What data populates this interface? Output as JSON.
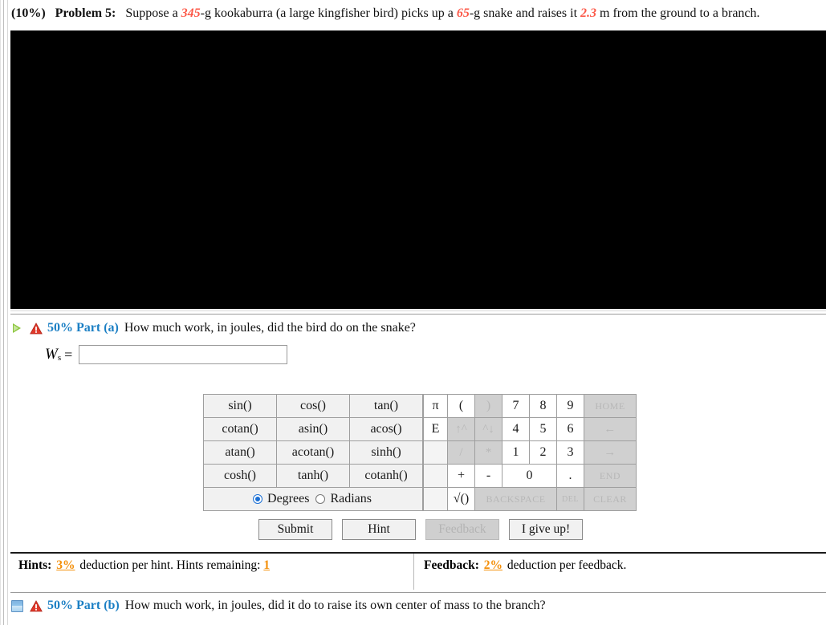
{
  "problem": {
    "percent": "(10%)",
    "label": "Problem 5:",
    "text_1": "Suppose a ",
    "val_mass_bird": "345",
    "text_2": "-g kookaburra (a large kingfisher bird) picks up a ",
    "val_mass_snake": "65",
    "text_3": "-g snake and raises it ",
    "val_height": "2.3",
    "text_4": " m from the ground to a branch."
  },
  "part_a": {
    "weight_label": "50% Part (a)",
    "question": "How much work, in joules, did the bird do on the snake?",
    "toggle_icon": "play-triangle-icon",
    "status_icon": "warning-icon"
  },
  "answer": {
    "symbol": "W",
    "subscript": "s",
    "equals": "=",
    "value": "",
    "placeholder": ""
  },
  "keypad": {
    "functions": [
      [
        "sin()",
        "cos()",
        "tan()"
      ],
      [
        "cotan()",
        "asin()",
        "acos()"
      ],
      [
        "atan()",
        "acotan()",
        "sinh()"
      ],
      [
        "cosh()",
        "tanh()",
        "cotanh()"
      ]
    ],
    "mode": {
      "degrees_label": "Degrees",
      "radians_label": "Radians",
      "selected": "Degrees"
    },
    "numeric": {
      "row1": [
        "π",
        "(",
        ")",
        "7",
        "8",
        "9",
        "HOME"
      ],
      "row2": [
        "E",
        "↑^",
        "^↓",
        "4",
        "5",
        "6",
        "←"
      ],
      "row3": [
        "",
        "/",
        "*",
        "1",
        "2",
        "3",
        "→"
      ],
      "row4": [
        "",
        "+",
        "-",
        "0",
        ".",
        "END"
      ],
      "row5": [
        "",
        "√()",
        "BACKSPACE",
        "DEL",
        "CLEAR"
      ]
    }
  },
  "actions": {
    "submit": "Submit",
    "hint": "Hint",
    "feedback": "Feedback",
    "give_up": "I give up!"
  },
  "hints": {
    "title": "Hints:",
    "deduction": "3%",
    "text_mid": " deduction per hint. Hints remaining: ",
    "remaining": "1"
  },
  "feedback": {
    "title": "Feedback:",
    "deduction": "2%",
    "text": " deduction per feedback."
  },
  "part_b": {
    "weight_label": "50% Part (b)",
    "question": "How much work, in joules, did it do to raise its own center of mass to the branch?",
    "toggle_icon": "collapsed-square-icon",
    "status_icon": "warning-icon"
  },
  "colors": {
    "accent_blue": "#1b7fc4",
    "value_red": "#fc5a4a",
    "orange": "#f4900c",
    "green": "#8cc63f"
  }
}
